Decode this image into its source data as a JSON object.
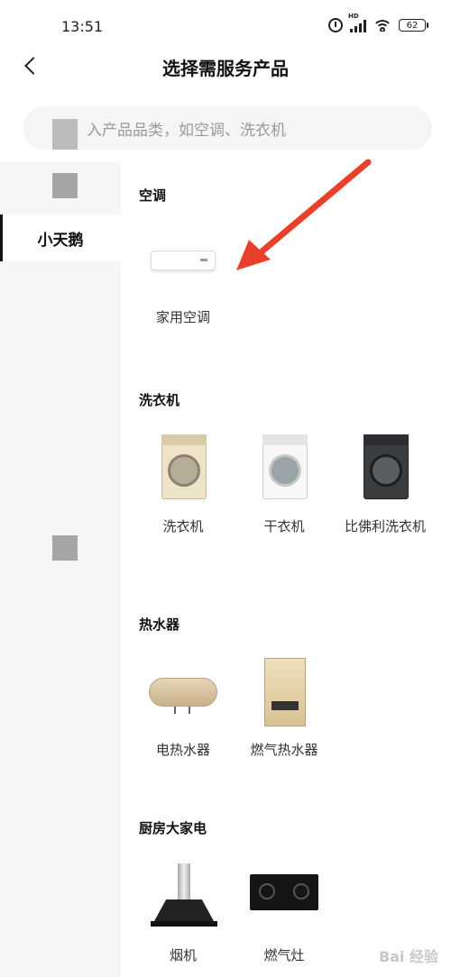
{
  "status_bar": {
    "time": "13:51",
    "signal_label": "HD",
    "battery": "62"
  },
  "header": {
    "title": "选择需服务产品"
  },
  "search": {
    "placeholder": "入产品品类，如空调、洗衣机"
  },
  "sidebar": {
    "items": [
      {
        "label": "小天鹅",
        "active": true
      }
    ]
  },
  "sections": [
    {
      "title": "空调",
      "products": [
        {
          "label": "家用空调",
          "icon": "air-conditioner-icon"
        }
      ]
    },
    {
      "title": "洗衣机",
      "products": [
        {
          "label": "洗衣机",
          "icon": "washing-machine-icon"
        },
        {
          "label": "干衣机",
          "icon": "dryer-icon"
        },
        {
          "label": "比佛利洗衣机",
          "icon": "washing-machine-dark-icon"
        }
      ]
    },
    {
      "title": "热水器",
      "products": [
        {
          "label": "电热水器",
          "icon": "electric-water-heater-icon"
        },
        {
          "label": "燃气热水器",
          "icon": "gas-water-heater-icon"
        }
      ]
    },
    {
      "title": "厨房大家电",
      "products": [
        {
          "label": "烟机",
          "icon": "range-hood-icon"
        },
        {
          "label": "燃气灶",
          "icon": "gas-stove-icon"
        }
      ]
    }
  ],
  "annotation": {
    "color": "#e8402b"
  },
  "watermark": {
    "text": "Bai 经验"
  }
}
